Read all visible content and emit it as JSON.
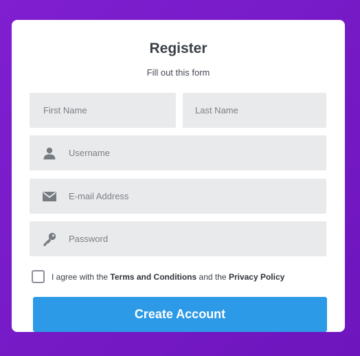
{
  "form": {
    "title": "Register",
    "subtitle": "Fill out this form",
    "first_name_placeholder": "First Name",
    "last_name_placeholder": "Last Name",
    "username_placeholder": "Username",
    "email_placeholder": "E-mail Address",
    "password_placeholder": "Password",
    "agree_prefix": "I agree with the ",
    "terms_link": "Terms and Conditions",
    "agree_middle": " and the ",
    "privacy_link": "Privacy Policy",
    "submit_label": "Create Account"
  },
  "icons": {
    "username": "user-icon",
    "email": "envelope-icon",
    "password": "key-icon"
  },
  "colors": {
    "background": "#7a1fc4",
    "accent": "#2c9ae6",
    "field_background": "#e9eaeb"
  }
}
